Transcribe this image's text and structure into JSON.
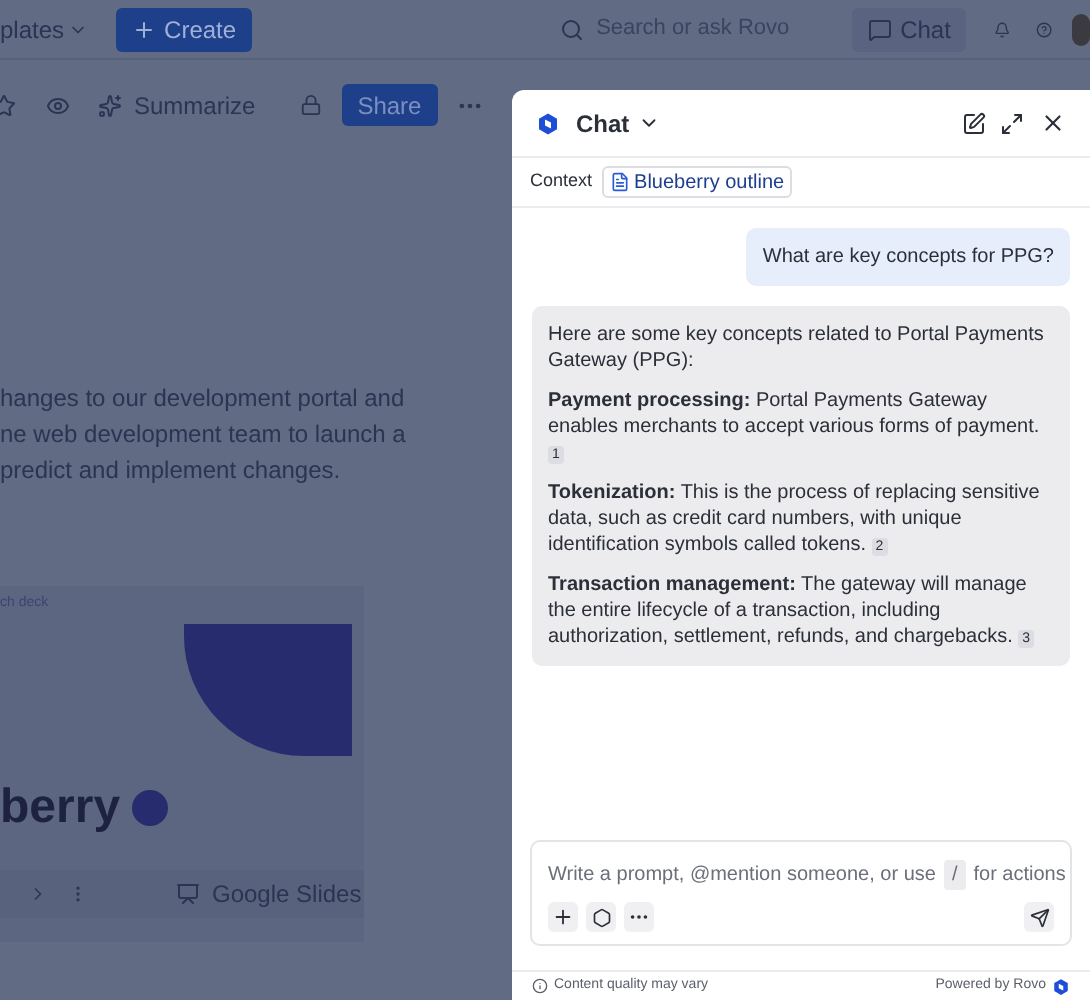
{
  "top_bar": {
    "templates_menu": "plates",
    "create_button": "Create",
    "search": {
      "placeholder": "Search or ask Rovo"
    },
    "chat_button": "Chat"
  },
  "page_toolbar": {
    "summarize_button": "Summarize",
    "share_button": "Share"
  },
  "page_body": {
    "paragraph_lines": [
      "hanges to our development portal and",
      "ne web development team to launch a",
      "predict and implement changes."
    ]
  },
  "embed_card": {
    "label": "ch deck",
    "slide_title": "berry",
    "source": "Google Slides"
  },
  "chat_panel": {
    "title": "Chat",
    "context_label": "Context",
    "context_chip": "Blueberry outline",
    "messages": [
      {
        "kind": "user",
        "text": "What are key concepts for PPG?"
      },
      {
        "kind": "assistant",
        "intro": "Here are some key concepts related to Portal Payments Gateway (PPG):",
        "points": [
          {
            "term": "Payment processing:",
            "text": "Portal Payments Gateway enables merchants to accept various forms of payment.",
            "citation": "1"
          },
          {
            "term": "Tokenization:",
            "text": "This is the process of replacing sensitive data, such as credit card numbers, with unique identification symbols called tokens.",
            "citation": "2"
          },
          {
            "term": "Transaction management:",
            "text": "The gateway will manage the entire lifecycle of a transaction, including authorization, settlement, refunds, and chargebacks.",
            "citation": "3"
          }
        ]
      }
    ],
    "prompt": {
      "placeholder_before": "Write a prompt, @mention someone, or use",
      "placeholder_key": "/",
      "placeholder_after": "for actions"
    },
    "footer": {
      "notice": "Content quality may vary",
      "powered_by": "Powered by Rovo"
    }
  }
}
